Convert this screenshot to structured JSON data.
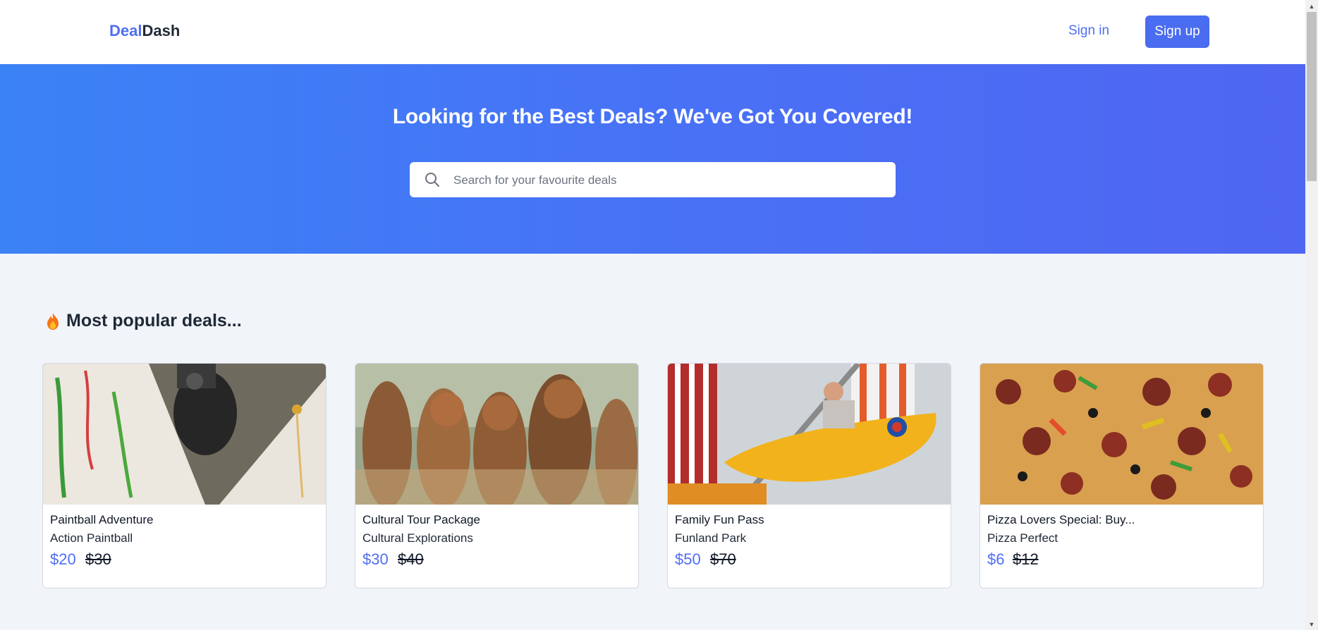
{
  "header": {
    "logo_part1": "Deal",
    "logo_part2": "Dash",
    "signin_label": "Sign in",
    "signup_label": "Sign up"
  },
  "hero": {
    "title": "Looking for the Best Deals? We've Got You Covered!",
    "search_placeholder": "Search for your favourite deals",
    "search_value": ""
  },
  "section": {
    "title": "Most popular deals..."
  },
  "deals": [
    {
      "title": "Paintball Adventure",
      "vendor": "Action Paintball",
      "price": "$20",
      "original_price": "$30"
    },
    {
      "title": "Cultural Tour Package",
      "vendor": "Cultural Explorations",
      "price": "$30",
      "original_price": "$40"
    },
    {
      "title": "Family Fun Pass",
      "vendor": "Funland Park",
      "price": "$50",
      "original_price": "$70"
    },
    {
      "title": "Pizza Lovers Special: Buy...",
      "vendor": "Pizza Perfect",
      "price": "$6",
      "original_price": "$12"
    }
  ],
  "colors": {
    "accent": "#4f6ef0",
    "hero_start": "#3b82f6",
    "hero_end": "#4f66f2",
    "background": "#f1f4f9"
  }
}
